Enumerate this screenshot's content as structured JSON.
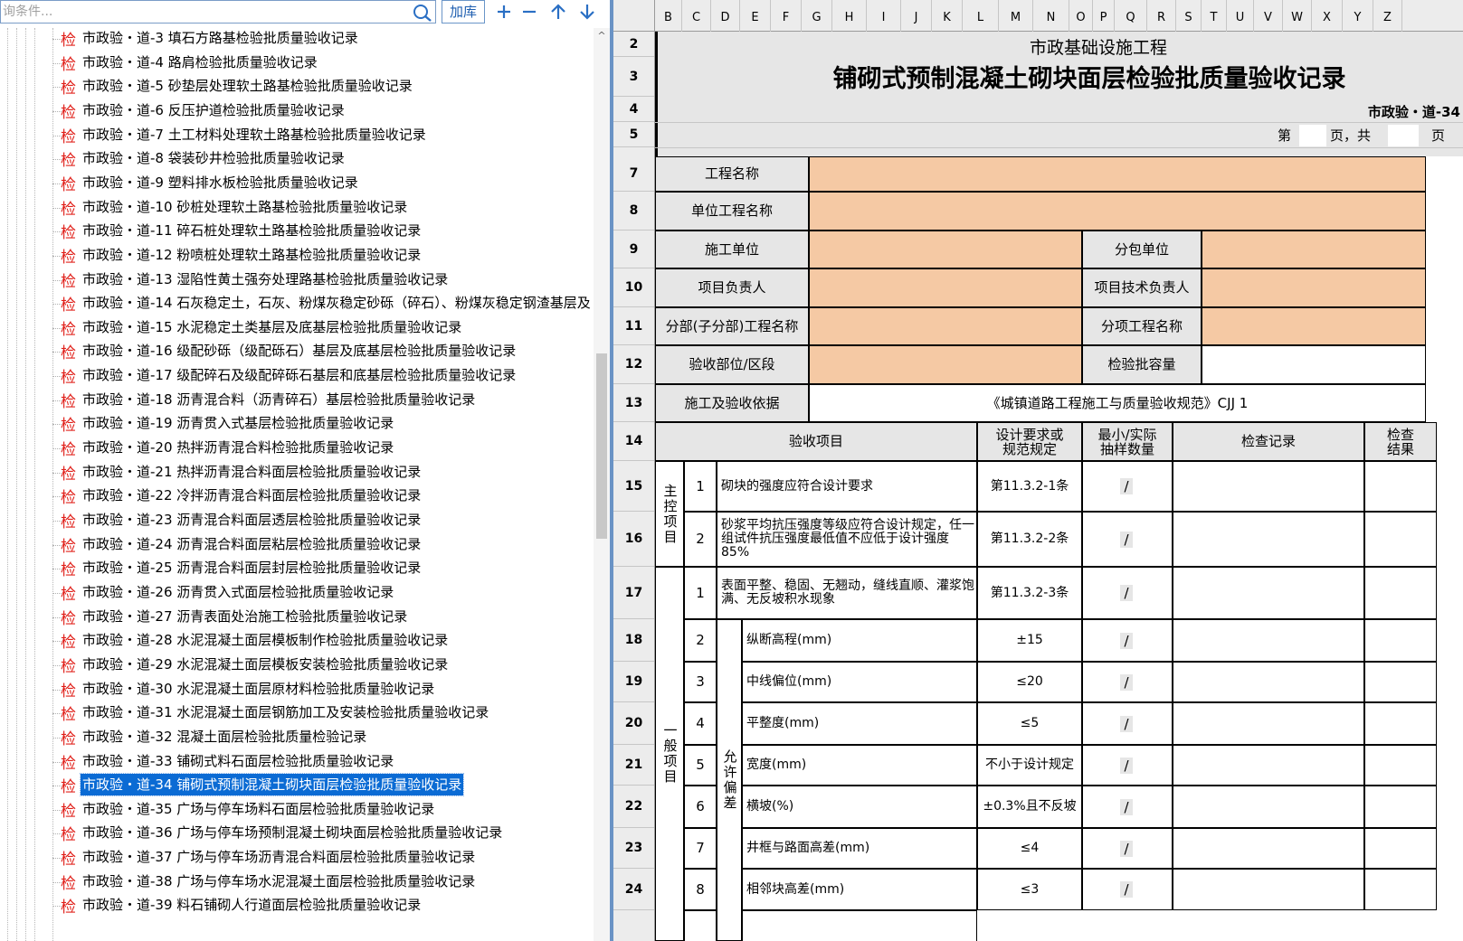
{
  "toolbar": {
    "search_placeholder": "询条件...",
    "add_lib_label": "加库",
    "add_icon": "plus-icon",
    "remove_icon": "minus-icon",
    "up_icon": "arrow-up-icon",
    "down_icon": "arrow-down-icon"
  },
  "tree": {
    "badge": "检",
    "selected_index": 31,
    "items": [
      "市政验・道-3 填石方路基检验批质量验收记录",
      "市政验・道-4 路肩检验批质量验收记录",
      "市政验・道-5 砂垫层处理软土路基检验批质量验收记录",
      "市政验・道-6 反压护道检验批质量验收记录",
      "市政验・道-7 土工材料处理软土路基检验批质量验收记录",
      "市政验・道-8 袋装砂井检验批质量验收记录",
      "市政验・道-9 塑料排水板检验批质量验收记录",
      "市政验・道-10 砂桩处理软土路基检验批质量验收记录",
      "市政验・道-11 碎石桩处理软土路基检验批质量验收记录",
      "市政验・道-12 粉喷桩处理软土路基检验批质量验收记录",
      "市政验・道-13 湿陷性黄土强夯处理路基检验批质量验收记录",
      "市政验・道-14 石灰稳定土，石灰、粉煤灰稳定砂砾（碎石）、粉煤灰稳定钢渣基层及",
      "市政验・道-15 水泥稳定土类基层及底基层检验批质量验收记录",
      "市政验・道-16 级配砂砾（级配砾石）基层及底基层检验批质量验收记录",
      "市政验・道-17 级配碎石及级配碎砾石基层和底基层检验批质量验收记录",
      "市政验・道-18 沥青混合料（沥青碎石）基层检验批质量验收记录",
      "市政验・道-19 沥青贯入式基层检验批质量验收记录",
      "市政验・道-20 热拌沥青混合料检验批质量验收记录",
      "市政验・道-21 热拌沥青混合料面层检验批质量验收记录",
      "市政验・道-22 冷拌沥青混合料面层检验批质量验收记录",
      "市政验・道-23 沥青混合料面层透层检验批质量验收记录",
      "市政验・道-24 沥青混合料面层粘层检验批质量验收记录",
      "市政验・道-25 沥青混合料面层封层检验批质量验收记录",
      "市政验・道-26 沥青贯入式面层检验批质量验收记录",
      "市政验・道-27 沥青表面处治施工检验批质量验收记录",
      "市政验・道-28 水泥混凝土面层模板制作检验批质量验收记录",
      "市政验・道-29 水泥混凝土面层模板安装检验批质量验收记录",
      "市政验・道-30 水泥混凝土面层原材料检验批质量验收记录",
      "市政验・道-31 水泥混凝土面层钢筋加工及安装检验批质量验收记录",
      "市政验・道-32 混凝土面层检验批质量检验记录",
      "市政验・道-33 铺砌式料石面层检验批质量验收记录",
      "市政验・道-34 铺砌式预制混凝土砌块面层检验批质量验收记录",
      "市政验・道-35 广场与停车场料石面层检验批质量验收记录",
      "市政验・道-36 广场与停车场预制混凝土砌块面层检验批质量验收记录",
      "市政验・道-37 广场与停车场沥青混合料面层检验批质量验收记录",
      "市政验・道-38 广场与停车场水泥混凝土面层检验批质量验收记录",
      "市政验・道-39 料石铺砌人行道面层检验批质量验收记录"
    ]
  },
  "sheet": {
    "columns": [
      "B",
      "C",
      "D",
      "E",
      "F",
      "G",
      "H",
      "I",
      "J",
      "K",
      "L",
      "M",
      "N",
      "O",
      "P",
      "Q",
      "R",
      "S",
      "T",
      "U",
      "V",
      "W",
      "X",
      "Y",
      "Z"
    ],
    "rows": [
      "2",
      "3",
      "4",
      "5",
      "7",
      "8",
      "9",
      "10",
      "11",
      "12",
      "13",
      "14",
      "15",
      "16",
      "17",
      "18",
      "19",
      "20",
      "21",
      "22",
      "23",
      "24"
    ],
    "subtitle": "市政基础设施工程",
    "title": "铺砌式预制混凝土砌块面层检验批质量验收记录",
    "code": "市政验・道-34",
    "page_prefix": "第",
    "page_mid": "页，共",
    "page_suffix": "页",
    "labels": {
      "project_name": "工程名称",
      "unit_project_name": "单位工程名称",
      "constructor": "施工单位",
      "subcontractor": "分包单位",
      "project_manager": "项目负责人",
      "tech_manager": "项目技术负责人",
      "division_name": "分部(子分部)工程名称",
      "subitem_name": "分项工程名称",
      "part": "验收部位/区段",
      "batch_capacity": "检验批容量",
      "basis": "施工及验收依据",
      "basis_value": "《城镇道路工程施工与质量验收规范》CJJ 1"
    },
    "headers": {
      "item": "验收项目",
      "design_req": "设计要求或规范规定",
      "sample": "最小/实际抽样数量",
      "record": "检查记录",
      "result": "检查结果"
    },
    "group_main": "主控项目",
    "group_general": "一般项目",
    "group_tolerance": "允许偏差",
    "main_items": [
      {
        "no": "1",
        "text": "砌块的强度应符合设计要求",
        "req": "第11.3.2-1条",
        "slash": "/"
      },
      {
        "no": "2",
        "text": "砂浆平均抗压强度等级应符合设计规定，任一组试件抗压强度最低值不应低于设计强度85%",
        "req": "第11.3.2-2条",
        "slash": "/"
      }
    ],
    "general_first": {
      "no": "1",
      "text": "表面平整、稳固、无翘动，缝线直顺、灌浆饱满、无反坡积水现象",
      "req": "第11.3.2-3条",
      "slash": "/"
    },
    "tolerance_items": [
      {
        "no": "2",
        "text": "纵断高程(mm)",
        "req": "±15",
        "slash": "/"
      },
      {
        "no": "3",
        "text": "中线偏位(mm)",
        "req": "≤20",
        "slash": "/"
      },
      {
        "no": "4",
        "text": "平整度(mm)",
        "req": "≤5",
        "slash": "/"
      },
      {
        "no": "5",
        "text": "宽度(mm)",
        "req": "不小于设计规定",
        "slash": "/"
      },
      {
        "no": "6",
        "text": "横坡(%)",
        "req": "±0.3%且不反坡",
        "slash": "/"
      },
      {
        "no": "7",
        "text": "井框与路面高差(mm)",
        "req": "≤4",
        "slash": "/"
      },
      {
        "no": "8",
        "text": "相邻块高差(mm)",
        "req": "≤3",
        "slash": "/"
      }
    ]
  },
  "colors": {
    "selection": "#0b6bd4",
    "badge": "#e0201a",
    "input_fill": "#f5c9a4",
    "header_gray": "#e6e6e6",
    "accent_blue": "#1f5fb0"
  }
}
